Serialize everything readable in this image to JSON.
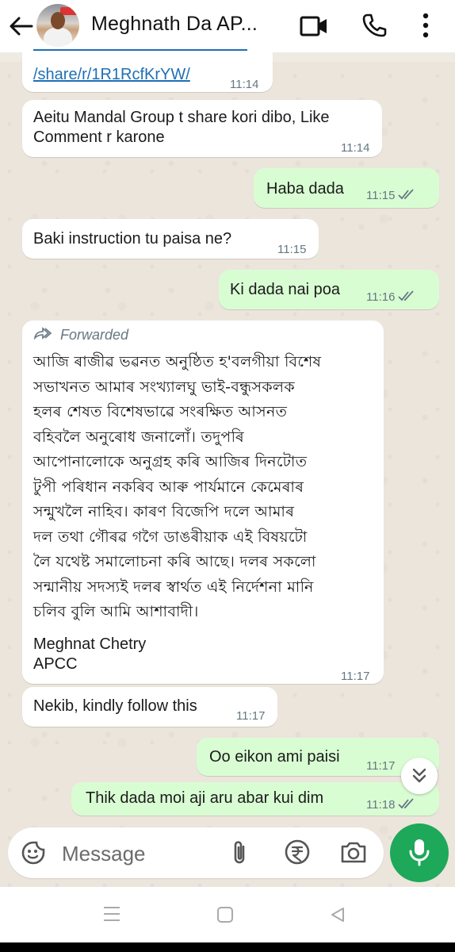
{
  "header": {
    "contact_name": "Meghnath Da AP...",
    "icons": [
      "back-arrow-icon",
      "video-call-icon",
      "voice-call-icon",
      "more-options-icon"
    ]
  },
  "messages": [
    {
      "id": "m1",
      "direction": "in",
      "link_text": "/share/r/1R1RcfKrYW/",
      "time": "11:14"
    },
    {
      "id": "m2",
      "direction": "in",
      "line1": "Aeitu Mandal Group t share kori dibo, Like",
      "line2": "Comment r karone",
      "time": "11:14"
    },
    {
      "id": "m3",
      "direction": "out",
      "text": "Haba dada",
      "time": "11:15"
    },
    {
      "id": "m4",
      "direction": "in",
      "text": "Baki instruction tu paisa ne?",
      "time": "11:15"
    },
    {
      "id": "m5",
      "direction": "out",
      "text": "Ki dada nai poa",
      "time": "11:16"
    },
    {
      "id": "m6",
      "direction": "in",
      "forwarded_label": "Forwarded",
      "lines": [
        "আজি ৰাজীৱ ভৱনত অনুষ্ঠিত হ'বলগীয়া বিশেষ",
        "সভাখনত আমাৰ সংখ্যালঘু ভাই-বন্ধুসকলক",
        "হলৰ শেষত বিশেষভাৱে সংৰক্ষিত আসনত",
        "বহিবলৈ অনুৰোধ জনালোঁ। তদুপৰি",
        "আপোনালোকে অনুগ্ৰহ কৰি আজিৰ দিনটোত",
        "টুপী পৰিধান নকৰিব আৰু পাৰ্যমানে কেমেৰাৰ",
        "সন্মুখলৈ নাহিব। কাৰণ বিজেপি দলে আমাৰ",
        "দল তথা গৌৰৱ গগৈ ডাঙৰীয়াক এই বিষয়টো",
        "লৈ যথেষ্ট সমালোচনা কৰি আছে। দলৰ সকলো",
        "সন্মানীয় সদস্যই দলৰ স্বাৰ্থত এই নিৰ্দেশনা মানি",
        "চলিব বুলি আমি আশাবাদী।"
      ],
      "signature_name": "Meghnat Chetry",
      "signature_org": "APCC",
      "time": "11:17"
    },
    {
      "id": "m7",
      "direction": "in",
      "text": "Nekib, kindly follow this",
      "time": "11:17"
    },
    {
      "id": "m8",
      "direction": "out",
      "text": "Oo eikon ami paisi",
      "time": "11:17"
    },
    {
      "id": "m9",
      "direction": "out",
      "text": "Thik dada moi aji aru abar kui dim",
      "time": "11:18"
    }
  ],
  "composer": {
    "placeholder": "Message",
    "icons": [
      "emoji-icon",
      "attach-icon",
      "payment-icon",
      "camera-icon",
      "mic-icon"
    ]
  },
  "navbar": {
    "icons": [
      "recents-icon",
      "home-icon",
      "back-icon"
    ]
  },
  "colors": {
    "incoming_bubble": "#ffffff",
    "outgoing_bubble": "#d9fdd3",
    "accent_green": "#1da85a",
    "chat_background": "#ece5dc",
    "link": "#1f6fb5"
  }
}
